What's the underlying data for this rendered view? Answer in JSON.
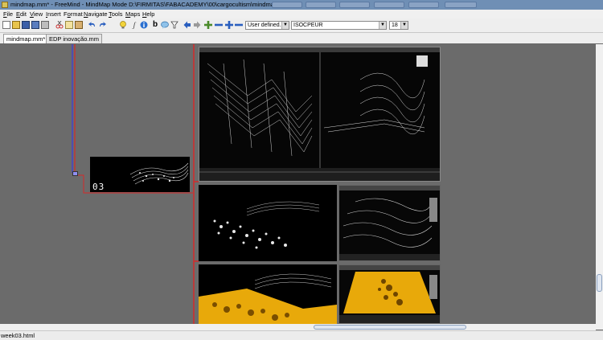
{
  "window": {
    "title": "mindmap.mm* - FreeMind - MindMap Mode D:\\FIRMITAS\\FABACADEMY\\00\\cargocultism\\mindmap.mm"
  },
  "menu": {
    "items": [
      {
        "label": "File",
        "key": "F"
      },
      {
        "label": "Edit",
        "key": "E"
      },
      {
        "label": "View",
        "key": "V"
      },
      {
        "label": "Insert",
        "key": "I"
      },
      {
        "label": "Format",
        "key": "o"
      },
      {
        "label": "Navigate",
        "key": "N"
      },
      {
        "label": "Tools",
        "key": "T"
      },
      {
        "label": "Maps",
        "key": "M"
      },
      {
        "label": "Help",
        "key": "H"
      }
    ]
  },
  "toolbar": {
    "style_combo": "User defined.",
    "font_combo": "ISOCPEUR",
    "size_combo": "18"
  },
  "tabs": [
    {
      "label": "mindmap.mm*"
    },
    {
      "label": "EDP inovação.mm"
    }
  ],
  "canvas": {
    "node_label": "03"
  },
  "statusbar": {
    "text": "week03.html"
  },
  "colors": {
    "canvas_bg": "#6b6b6b",
    "edge_red": "#d42a2a",
    "edge_blue": "#3a3ae0",
    "mesh_yellow": "#e8a90a"
  },
  "icons": [
    "new-icon",
    "open-icon",
    "save-icon",
    "save-as-icon",
    "print-icon",
    "cut-icon",
    "copy-icon",
    "paste-icon",
    "undo-icon",
    "redo-icon",
    "bulb-icon",
    "italic-icon",
    "info-icon",
    "bold-icon",
    "speech-bubble-icon",
    "filter-icon",
    "back-icon",
    "forward-icon",
    "zoom-in-icon",
    "zoom-out-icon"
  ]
}
